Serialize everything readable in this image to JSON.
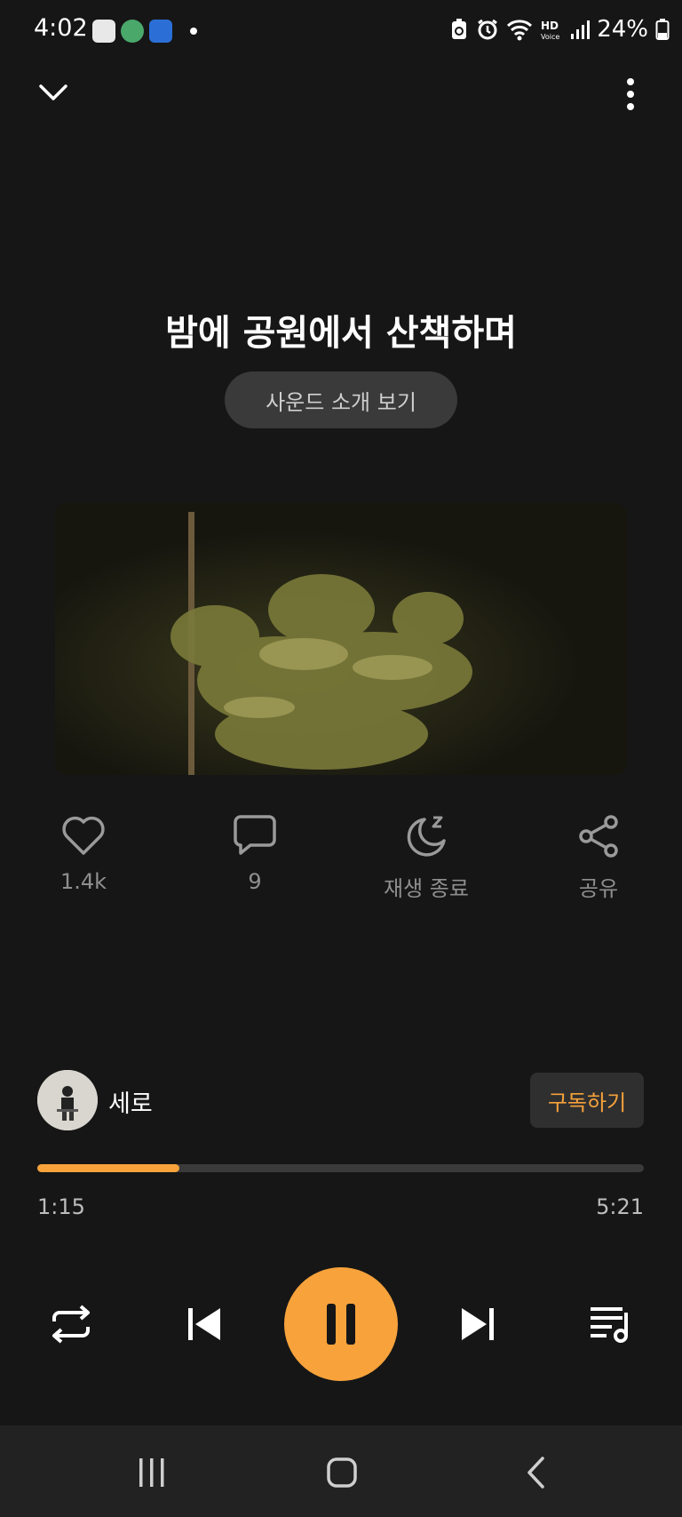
{
  "status_bar": {
    "time": "4:02",
    "battery": "24%",
    "icons": [
      "recycle-icon",
      "alarm-icon",
      "wifi-icon",
      "hd-voice-icon",
      "signal-icon",
      "battery-icon"
    ]
  },
  "track": {
    "title": "밤에 공원에서 산책하며",
    "intro_button": "사운드 소개 보기"
  },
  "actions": {
    "like_count": "1.4k",
    "comment_count": "9",
    "sleep_timer_label": "재생 종료",
    "share_label": "공유"
  },
  "artist": {
    "name": "세로",
    "subscribe_label": "구독하기"
  },
  "progress": {
    "current": "1:15",
    "total": "5:21",
    "fraction": 0.234
  },
  "colors": {
    "accent": "#f7a23b",
    "background": "#161616"
  }
}
